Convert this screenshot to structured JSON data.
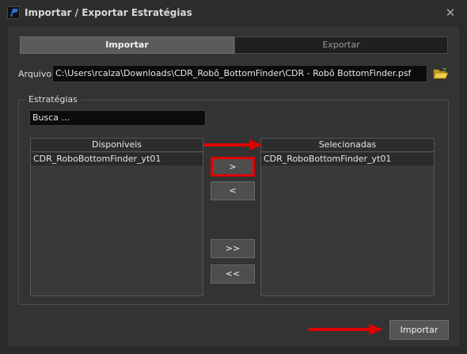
{
  "window": {
    "title": "Importar / Exportar Estratégias",
    "close_glyph": "✕"
  },
  "tabs": [
    {
      "label": "Importar",
      "active": true
    },
    {
      "label": "Exportar",
      "active": false
    }
  ],
  "arquivo": {
    "label": "Arquivo",
    "value": "C:\\Users\\rcalza\\Downloads\\CDR_Robô_BottomFinder\\CDR - Robô BottomFinder.psf",
    "browse_icon": "folder-open-icon"
  },
  "estrategias": {
    "group_label": "Estratégias",
    "search_value": "Busca ...",
    "disponiveis": {
      "header": "Disponíveis",
      "items": [
        "CDR_RoboBottomFinder_yt01"
      ]
    },
    "selecionadas": {
      "header": "Selecionadas",
      "items": [
        "CDR_RoboBottomFinder_yt01"
      ]
    },
    "buttons": {
      "move_right": ">",
      "move_left": "<",
      "move_all_right": ">>",
      "move_all_left": "<<"
    }
  },
  "footer": {
    "import_label": "Importar"
  },
  "colors": {
    "annotation_red": "#e00000",
    "background": "#2b2b2b",
    "accent_blue": "#2a6fd6"
  }
}
